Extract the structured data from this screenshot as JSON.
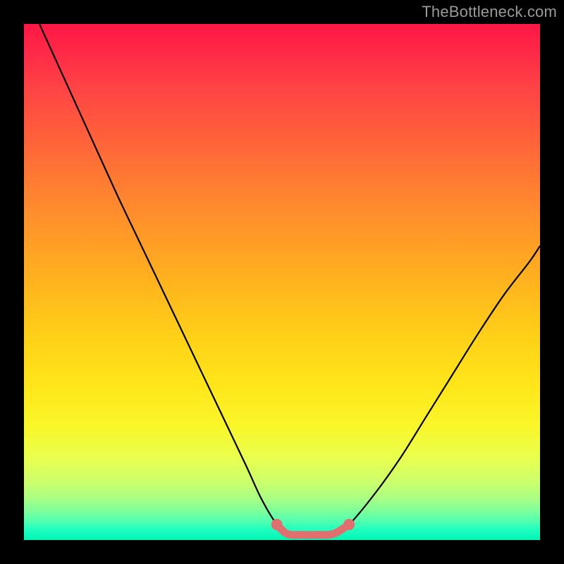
{
  "watermark": {
    "text": "TheBottleneck.com"
  },
  "colors": {
    "frame": "#000000",
    "curve": "#000000",
    "marker": "#e07070",
    "markerFill": "#e07070",
    "watermark": "#9a9a9a",
    "gradient_stops": [
      "#ff1745",
      "#ff2b47",
      "#ff4246",
      "#ff5a3c",
      "#ff7a33",
      "#ff9728",
      "#ffb31e",
      "#ffcf18",
      "#ffe61a",
      "#f9f62a",
      "#eaff4d",
      "#caff6e",
      "#a8ff84",
      "#7bff9c",
      "#4dffb1",
      "#1fffbf",
      "#00f5b5"
    ]
  },
  "chart_data": {
    "type": "line",
    "title": "",
    "xlabel": "",
    "ylabel": "",
    "xlim": [
      0,
      100
    ],
    "ylim": [
      0,
      100
    ],
    "grid": false,
    "series": [
      {
        "name": "bottleneck-curve",
        "x": [
          3,
          8,
          13,
          18,
          23,
          28,
          33,
          38,
          43,
          46,
          49,
          51,
          54,
          57,
          60,
          63,
          68,
          73,
          78,
          83,
          88,
          93,
          98,
          100
        ],
        "y": [
          100,
          89,
          78,
          67,
          56.5,
          46,
          35.5,
          25,
          14.5,
          8,
          3,
          1.2,
          1.0,
          1.0,
          1.2,
          3,
          9,
          16,
          24,
          32,
          40,
          47.5,
          54,
          57
        ]
      },
      {
        "name": "optimal-range-marker",
        "x": [
          49,
          51,
          54,
          57,
          60,
          63
        ],
        "y": [
          3,
          1.2,
          1.0,
          1.0,
          1.2,
          3
        ]
      }
    ],
    "annotations": []
  }
}
